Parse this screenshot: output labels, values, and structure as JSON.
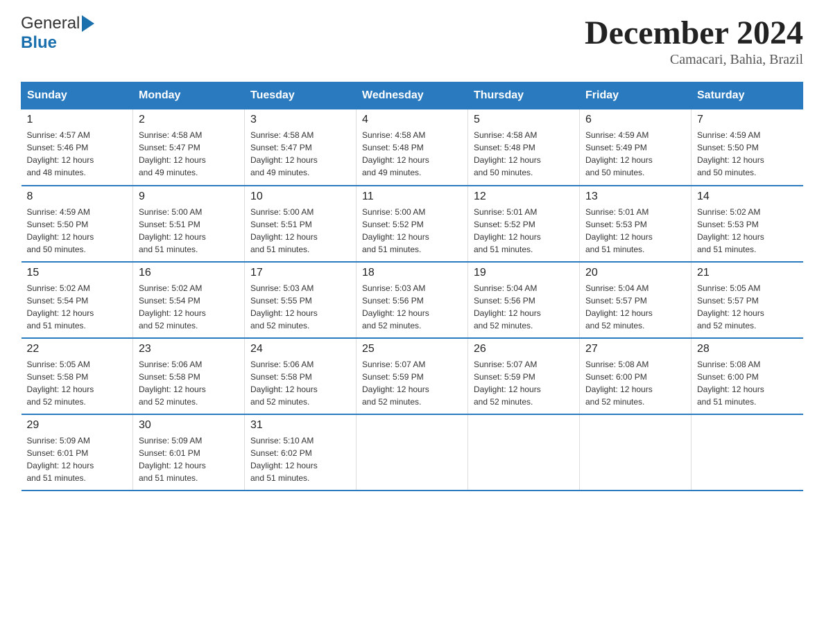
{
  "header": {
    "logo_general": "General",
    "logo_blue": "Blue",
    "month_title": "December 2024",
    "location": "Camacari, Bahia, Brazil"
  },
  "days_of_week": [
    "Sunday",
    "Monday",
    "Tuesday",
    "Wednesday",
    "Thursday",
    "Friday",
    "Saturday"
  ],
  "weeks": [
    [
      {
        "num": "1",
        "sunrise": "4:57 AM",
        "sunset": "5:46 PM",
        "daylight": "12 hours and 48 minutes."
      },
      {
        "num": "2",
        "sunrise": "4:58 AM",
        "sunset": "5:47 PM",
        "daylight": "12 hours and 49 minutes."
      },
      {
        "num": "3",
        "sunrise": "4:58 AM",
        "sunset": "5:47 PM",
        "daylight": "12 hours and 49 minutes."
      },
      {
        "num": "4",
        "sunrise": "4:58 AM",
        "sunset": "5:48 PM",
        "daylight": "12 hours and 49 minutes."
      },
      {
        "num": "5",
        "sunrise": "4:58 AM",
        "sunset": "5:48 PM",
        "daylight": "12 hours and 50 minutes."
      },
      {
        "num": "6",
        "sunrise": "4:59 AM",
        "sunset": "5:49 PM",
        "daylight": "12 hours and 50 minutes."
      },
      {
        "num": "7",
        "sunrise": "4:59 AM",
        "sunset": "5:50 PM",
        "daylight": "12 hours and 50 minutes."
      }
    ],
    [
      {
        "num": "8",
        "sunrise": "4:59 AM",
        "sunset": "5:50 PM",
        "daylight": "12 hours and 50 minutes."
      },
      {
        "num": "9",
        "sunrise": "5:00 AM",
        "sunset": "5:51 PM",
        "daylight": "12 hours and 51 minutes."
      },
      {
        "num": "10",
        "sunrise": "5:00 AM",
        "sunset": "5:51 PM",
        "daylight": "12 hours and 51 minutes."
      },
      {
        "num": "11",
        "sunrise": "5:00 AM",
        "sunset": "5:52 PM",
        "daylight": "12 hours and 51 minutes."
      },
      {
        "num": "12",
        "sunrise": "5:01 AM",
        "sunset": "5:52 PM",
        "daylight": "12 hours and 51 minutes."
      },
      {
        "num": "13",
        "sunrise": "5:01 AM",
        "sunset": "5:53 PM",
        "daylight": "12 hours and 51 minutes."
      },
      {
        "num": "14",
        "sunrise": "5:02 AM",
        "sunset": "5:53 PM",
        "daylight": "12 hours and 51 minutes."
      }
    ],
    [
      {
        "num": "15",
        "sunrise": "5:02 AM",
        "sunset": "5:54 PM",
        "daylight": "12 hours and 51 minutes."
      },
      {
        "num": "16",
        "sunrise": "5:02 AM",
        "sunset": "5:54 PM",
        "daylight": "12 hours and 52 minutes."
      },
      {
        "num": "17",
        "sunrise": "5:03 AM",
        "sunset": "5:55 PM",
        "daylight": "12 hours and 52 minutes."
      },
      {
        "num": "18",
        "sunrise": "5:03 AM",
        "sunset": "5:56 PM",
        "daylight": "12 hours and 52 minutes."
      },
      {
        "num": "19",
        "sunrise": "5:04 AM",
        "sunset": "5:56 PM",
        "daylight": "12 hours and 52 minutes."
      },
      {
        "num": "20",
        "sunrise": "5:04 AM",
        "sunset": "5:57 PM",
        "daylight": "12 hours and 52 minutes."
      },
      {
        "num": "21",
        "sunrise": "5:05 AM",
        "sunset": "5:57 PM",
        "daylight": "12 hours and 52 minutes."
      }
    ],
    [
      {
        "num": "22",
        "sunrise": "5:05 AM",
        "sunset": "5:58 PM",
        "daylight": "12 hours and 52 minutes."
      },
      {
        "num": "23",
        "sunrise": "5:06 AM",
        "sunset": "5:58 PM",
        "daylight": "12 hours and 52 minutes."
      },
      {
        "num": "24",
        "sunrise": "5:06 AM",
        "sunset": "5:58 PM",
        "daylight": "12 hours and 52 minutes."
      },
      {
        "num": "25",
        "sunrise": "5:07 AM",
        "sunset": "5:59 PM",
        "daylight": "12 hours and 52 minutes."
      },
      {
        "num": "26",
        "sunrise": "5:07 AM",
        "sunset": "5:59 PM",
        "daylight": "12 hours and 52 minutes."
      },
      {
        "num": "27",
        "sunrise": "5:08 AM",
        "sunset": "6:00 PM",
        "daylight": "12 hours and 52 minutes."
      },
      {
        "num": "28",
        "sunrise": "5:08 AM",
        "sunset": "6:00 PM",
        "daylight": "12 hours and 51 minutes."
      }
    ],
    [
      {
        "num": "29",
        "sunrise": "5:09 AM",
        "sunset": "6:01 PM",
        "daylight": "12 hours and 51 minutes."
      },
      {
        "num": "30",
        "sunrise": "5:09 AM",
        "sunset": "6:01 PM",
        "daylight": "12 hours and 51 minutes."
      },
      {
        "num": "31",
        "sunrise": "5:10 AM",
        "sunset": "6:02 PM",
        "daylight": "12 hours and 51 minutes."
      },
      null,
      null,
      null,
      null
    ]
  ],
  "labels": {
    "sunrise": "Sunrise:",
    "sunset": "Sunset:",
    "daylight": "Daylight:"
  }
}
